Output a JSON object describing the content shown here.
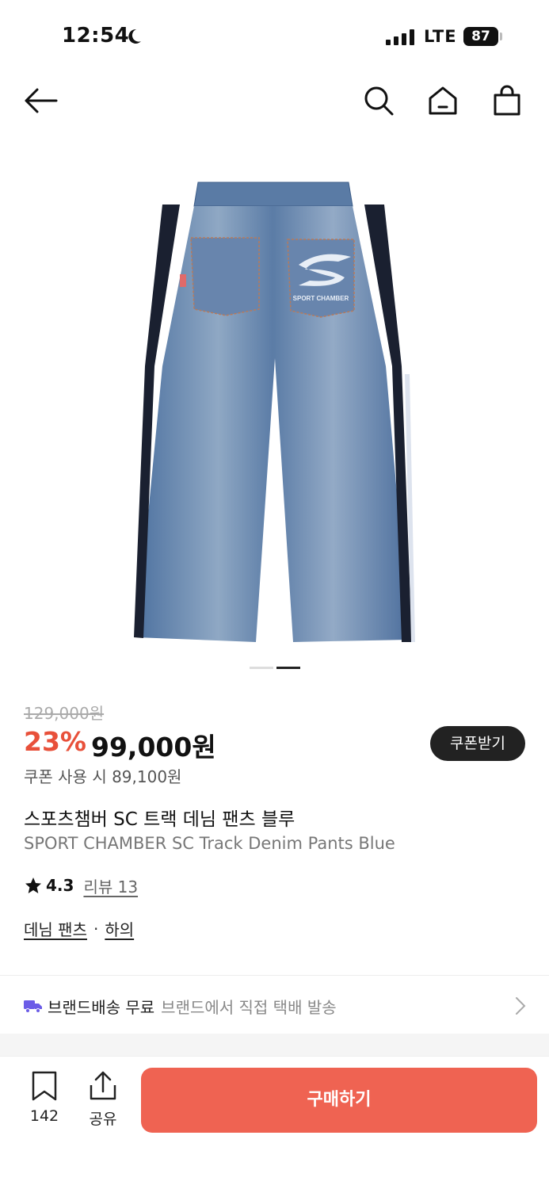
{
  "status_bar": {
    "time": "12:54",
    "network": "LTE",
    "battery": "87"
  },
  "nav": {
    "icons": [
      "back-arrow-icon",
      "search-icon",
      "home-icon",
      "shopping-bag-icon"
    ]
  },
  "product": {
    "image_description_icon": "denim-pants-image",
    "pager": {
      "total": 2,
      "active": 2
    },
    "original_price": "129,000원",
    "discount_rate": "23%",
    "sale_price": "99,000원",
    "coupon_button": "쿠폰받기",
    "coupon_price": "쿠폰 사용 시 89,100원",
    "title": "스포츠챔버 SC 트랙 데님 팬츠 블루",
    "subtitle": "SPORT CHAMBER SC Track Denim Pants Blue",
    "rating": "4.3",
    "review_link": "리뷰 13",
    "categories": [
      "데님 팬츠",
      "하의"
    ],
    "category_separator": "·"
  },
  "shipping": {
    "title": "브랜드배송 무료",
    "desc": "브랜드에서 직접 택배 발송",
    "icon_color": "#6b5ce7"
  },
  "bottom_bar": {
    "bookmark_count": "142",
    "share_label": "공유",
    "buy_label": "구매하기",
    "buy_color": "#ef6352"
  },
  "colors": {
    "discount": "#e8503a",
    "accent": "#ef6352"
  }
}
